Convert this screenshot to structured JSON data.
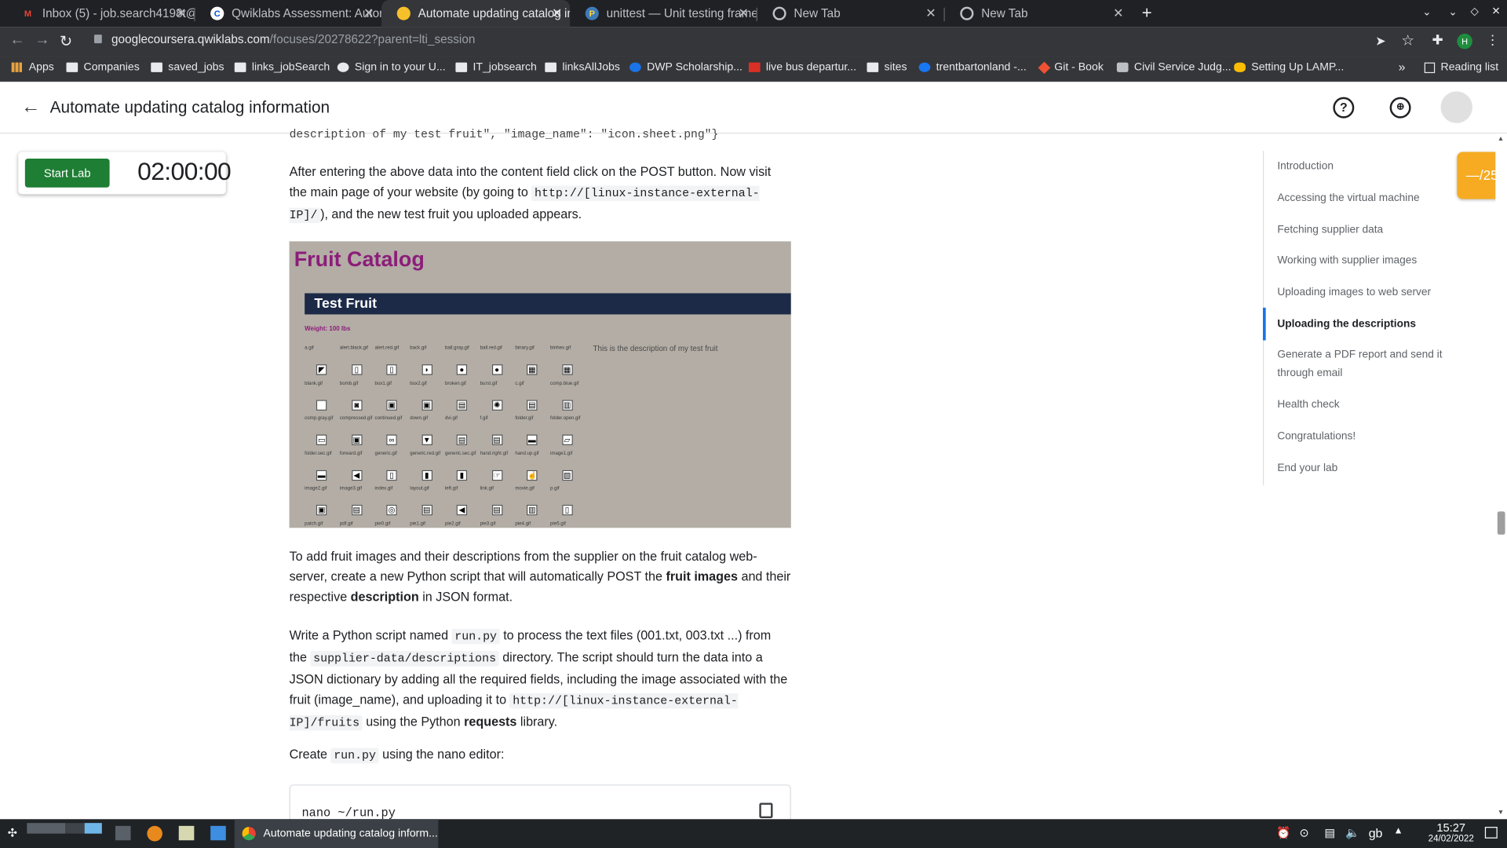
{
  "browser": {
    "tabs": [
      {
        "title": "Inbox (5) - job.search4198t@g",
        "icon": "gmail-icon"
      },
      {
        "title": "Qwiklabs Assessment: Autom",
        "icon": "coursera-icon"
      },
      {
        "title": "Automate updating catalog in",
        "icon": "qwiklabs-icon"
      },
      {
        "title": "unittest — Unit testing frame",
        "icon": "python-icon"
      },
      {
        "title": "New Tab",
        "icon": "chrome-icon"
      },
      {
        "title": "New Tab",
        "icon": "chrome-icon"
      }
    ],
    "url_host": "googlecoursera.qwiklabs.com",
    "url_path": "/focuses/20278622?parent=lti_session",
    "profile_initial": "H",
    "bookmarks": [
      "Apps",
      "Companies",
      "saved_jobs",
      "links_jobSearch",
      "Sign in to your U...",
      "IT_jobsearch",
      "linksAllJobs",
      "DWP Scholarship...",
      "live bus departur...",
      "sites",
      "trentbartonland -...",
      "Git - Book",
      "Civil Service Judg...",
      "Setting Up LAMP..."
    ],
    "more_bookmarks": "»",
    "reading_list": "Reading list"
  },
  "app": {
    "title": "Automate updating catalog information",
    "start_lab": "Start Lab",
    "timer": "02:00:00",
    "score": "—/25"
  },
  "content": {
    "cut_line": "description of my test fruit\",  \"image_name\": \"icon.sheet.png\"}",
    "p1_a": "After entering the above data into the content field click on the POST button. Now visit the main page of your website (by going to ",
    "p1_code": "http://[linux-instance-external-IP]/",
    "p1_b": "), and the new test fruit you uploaded appears.",
    "p2_a": "To add fruit images and their descriptions from the supplier on the fruit catalog web-server, create a new Python script that will automatically POST the ",
    "p2_b1": "fruit images",
    "p2_c": " and their respective ",
    "p2_b2": "description",
    "p2_d": " in JSON format.",
    "p3_a": "Write a Python script named ",
    "p3_c1": "run.py",
    "p3_b": " to process the text files (001.txt, 003.txt ...) from the ",
    "p3_c2": "supplier-data/descriptions",
    "p3_d": " directory. The script should turn the data into a JSON dictionary by adding all the required fields, including the image associated with the fruit (image_name), and uploading it to ",
    "p3_c3": "http://[linux-instance-external-IP]/fruits",
    "p3_e": " using the Python ",
    "p3_b3": "requests",
    "p3_f": " library.",
    "p4_a": "Create ",
    "p4_c": "run.py",
    "p4_b": " using the nano editor:",
    "code": "nano ~/run.py"
  },
  "fruit_image": {
    "title": "Fruit Catalog",
    "name": "Test Fruit",
    "weight": "Weight: 100 lbs",
    "description": "This is the description of my test fruit",
    "icons": [
      "a.gif",
      "alert.black.gif",
      "alert.red.gif",
      "back.gif",
      "ball.gray.gif",
      "ball.red.gif",
      "binary.gif",
      "binhex.gif",
      "blank.gif",
      "bomb.gif",
      "box1.gif",
      "box2.gif",
      "broken.gif",
      "burst.gif",
      "c.gif",
      "comp.blue.gif",
      "comp.gray.gif",
      "compressed.gif",
      "continued.gif",
      "down.gif",
      "dvi.gif",
      "f.gif",
      "folder.gif",
      "folder.open.gif",
      "folder.sec.gif",
      "forward.gif",
      "generic.gif",
      "generic.red.gif",
      "generic.sec.gif",
      "hand.right.gif",
      "hand.up.gif",
      "image1.gif",
      "image2.gif",
      "image3.gif",
      "index.gif",
      "layout.gif",
      "left.gif",
      "link.gif",
      "movie.gif",
      "p.gif",
      "patch.gif",
      "pdf.gif",
      "pie0.gif",
      "pie1.gif",
      "pie2.gif",
      "pie3.gif",
      "pie4.gif",
      "pie5.gif"
    ]
  },
  "toc": [
    "Introduction",
    "Accessing the virtual machine",
    "Fetching supplier data",
    "Working with supplier images",
    "Uploading images to web server",
    "Uploading the descriptions",
    "Generate a PDF report and send it through email",
    "Health check",
    "Congratulations!",
    "End your lab"
  ],
  "taskbar": {
    "task": "Automate updating catalog inform...",
    "kbd": "gb",
    "time": "15:27",
    "date": "24/02/2022"
  }
}
